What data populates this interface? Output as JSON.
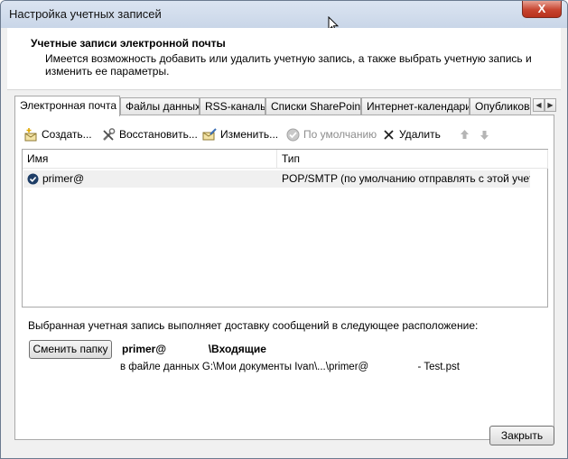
{
  "window": {
    "title": "Настройка учетных записей",
    "close_label": "X"
  },
  "header": {
    "title": "Учетные записи электронной почты",
    "description": "Имеется возможность добавить или удалить учетную запись, а также выбрать учетную запись и изменить ее параметры."
  },
  "tabs": [
    {
      "label": "Электронная почта",
      "active": true
    },
    {
      "label": "Файлы данных"
    },
    {
      "label": "RSS-каналы"
    },
    {
      "label": "Списки SharePoint"
    },
    {
      "label": "Интернет-календари"
    },
    {
      "label": "Опубликованные календари"
    }
  ],
  "tab_scroll": {
    "left": "◀",
    "right": "▶"
  },
  "toolbar": {
    "create": "Создать...",
    "repair": "Восстановить...",
    "change": "Изменить...",
    "set_default": "По умолчанию",
    "delete": "Удалить"
  },
  "list": {
    "columns": {
      "name": "Имя",
      "type": "Тип"
    },
    "rows": [
      {
        "name": "primer@",
        "type": "POP/SMTP (по умолчанию отправлять с этой учет..."
      }
    ]
  },
  "delivery": {
    "label": "Выбранная учетная запись выполняет доставку сообщений в следующее расположение:",
    "change_folder": "Сменить папку",
    "folder": "primer@              \\Входящие",
    "file_path": "в файле данных G:\\Мои документы Ivan\\...\\primer@                 - Test.pst"
  },
  "footer": {
    "close": "Закрыть"
  },
  "colors": {
    "accent": "#2b5797",
    "close_red": "#c7442f"
  }
}
